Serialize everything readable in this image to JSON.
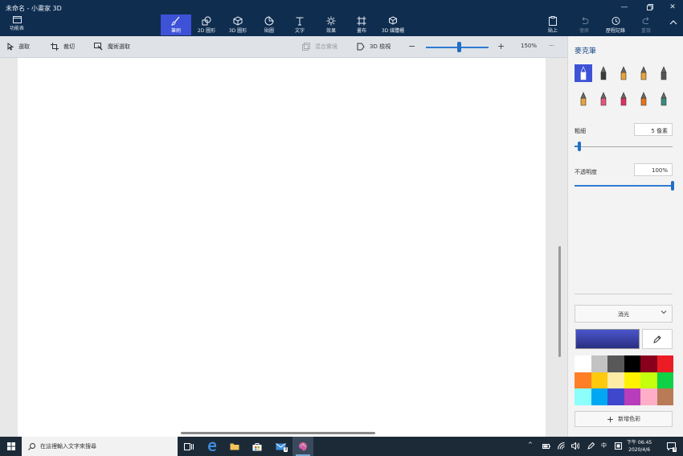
{
  "window": {
    "title": "未命名 - 小畫家 3D"
  },
  "ribbon": {
    "menu_label": "功能表",
    "tools": [
      {
        "label": "筆刷",
        "icon": "brush-icon",
        "active": true
      },
      {
        "label": "2D 圖形",
        "icon": "shapes-2d-icon"
      },
      {
        "label": "3D 圖形",
        "icon": "cube-icon"
      },
      {
        "label": "貼圖",
        "icon": "sticker-icon"
      },
      {
        "label": "文字",
        "icon": "text-icon"
      },
      {
        "label": "效果",
        "icon": "effects-icon"
      },
      {
        "label": "畫布",
        "icon": "canvas-icon"
      },
      {
        "label": "3D 媒體櫃",
        "icon": "library-icon"
      }
    ],
    "paste_label": "貼上",
    "undo_label": "復原",
    "history_label": "歷程記錄",
    "redo_label": "重做"
  },
  "subtoolbar": {
    "select_label": "選取",
    "crop_label": "裁切",
    "magic_select_label": "魔術選取",
    "mixed_reality_label": "混合實境",
    "view3d_label": "3D 檢視",
    "zoom_value": "150%",
    "zoom_level": 0.52,
    "more_label": "···"
  },
  "panel": {
    "title": "麥克筆",
    "brushes": [
      {
        "name": "marker",
        "color": "#ffffff"
      },
      {
        "name": "calligraphy-pen",
        "color": "#3a3a3a"
      },
      {
        "name": "oil-brush",
        "color": "#e8a33a"
      },
      {
        "name": "watercolor",
        "color": "#e8a33a"
      },
      {
        "name": "pixel-pen",
        "color": "#555555"
      },
      {
        "name": "pencil",
        "color": "#e8a33a"
      },
      {
        "name": "eraser",
        "color": "#e8557a"
      },
      {
        "name": "crayon",
        "color": "#e03060"
      },
      {
        "name": "spray-can",
        "color": "#e8741a"
      },
      {
        "name": "fill",
        "color": "#3a8a80"
      }
    ],
    "thickness_label": "粗細",
    "thickness_value": "5 像素",
    "thickness_level": 0.05,
    "opacity_label": "不透明度",
    "opacity_value": "100%",
    "opacity_level": 1.0,
    "finish_value": "消光",
    "current_color": "#4a55cc",
    "palette": [
      "#ffffff",
      "#c3c3c3",
      "#585858",
      "#000000",
      "#88001b",
      "#ec1c24",
      "#ff7f27",
      "#ffc90e",
      "#fdeca6",
      "#fff200",
      "#c4ff0e",
      "#0ed145",
      "#8cfffb",
      "#00a8f3",
      "#3f48cc",
      "#b83dba",
      "#ffaec8",
      "#b97a56"
    ],
    "add_color_label": "新增色彩"
  },
  "taskbar": {
    "search_placeholder": "在這裡輸入文字來搜尋",
    "mail_badge": "3",
    "ime_label": "中",
    "time": "下午 06:45",
    "date": "2020/4/6",
    "notif_badge": "3"
  }
}
